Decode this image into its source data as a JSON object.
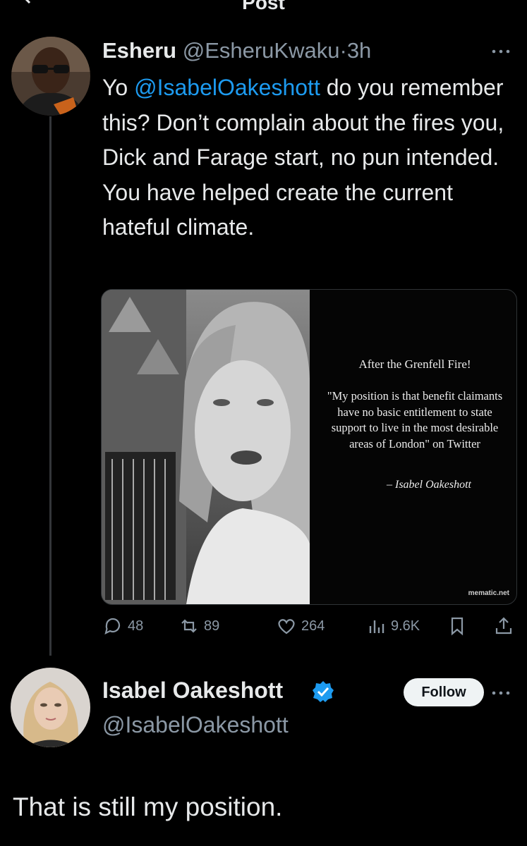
{
  "header": {
    "title": "Post"
  },
  "tweet1": {
    "display_name": "Esheru",
    "handle": "@EsheruKwaku",
    "separator": "·",
    "time": "3h",
    "text_prefix": "Yo ",
    "mention": "@IsabelOakeshott",
    "text_suffix": " do you remember this? Don’t complain about the fires you, Dick and Farage start, no pun intended. You have helped create the current hateful climate.",
    "media": {
      "heading": "After the Grenfell Fire!",
      "quote": "\"My position is that benefit claimants have no basic entitlement to state support to live in the most desirable areas of London\" on Twitter",
      "author": "– Isabel Oakeshott",
      "watermark": "mematic.net"
    },
    "stats": {
      "replies": "48",
      "reposts": "89",
      "likes": "264",
      "views": "9.6K"
    }
  },
  "tweet2": {
    "display_name": "Isabel Oakeshott",
    "handle": "@IsabelOakeshott",
    "follow_label": "Follow",
    "text": "That is still my position."
  },
  "colors": {
    "accent": "#1d9bf0",
    "muted": "#8b98a5",
    "background": "#000000"
  }
}
